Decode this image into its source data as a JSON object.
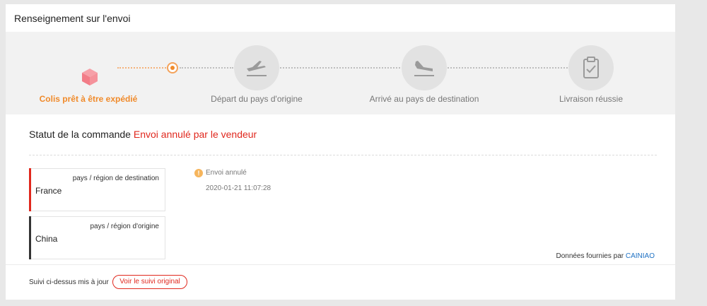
{
  "panel": {
    "title": "Renseignement sur l'envoi"
  },
  "tracker": {
    "steps": [
      {
        "label": "Colis prêt à être expédié",
        "icon": "package-icon",
        "state": "current"
      },
      {
        "label": "Départ du pays d'origine",
        "icon": "plane-departure-icon",
        "state": "pending"
      },
      {
        "label": "Arrivé au pays de destination",
        "icon": "plane-arrival-icon",
        "state": "pending"
      },
      {
        "label": "Livraison réussie",
        "icon": "clipboard-check-icon",
        "state": "pending"
      }
    ]
  },
  "status": {
    "label": "Statut de la commande",
    "value": "Envoi annulé par le vendeur"
  },
  "locations": {
    "destination": {
      "kind": "pays / région de destination",
      "name": "France",
      "color": "#e0281e"
    },
    "origin": {
      "kind": "pays / région d'origine",
      "name": "China",
      "color": "#333333"
    }
  },
  "event": {
    "icon": "info-icon",
    "icon_glyph": "!",
    "text": "Envoi annulé",
    "time": "2020-01-21 11:07:28"
  },
  "credit": {
    "text": "Données fournies par",
    "link": "CAINIAO"
  },
  "footer": {
    "text": "Suivi ci-dessus mis à jour",
    "button": "Voir le suivi original"
  },
  "colors": {
    "accent": "#f08a2a",
    "alert": "#e0281e",
    "link": "#1f72c4"
  }
}
